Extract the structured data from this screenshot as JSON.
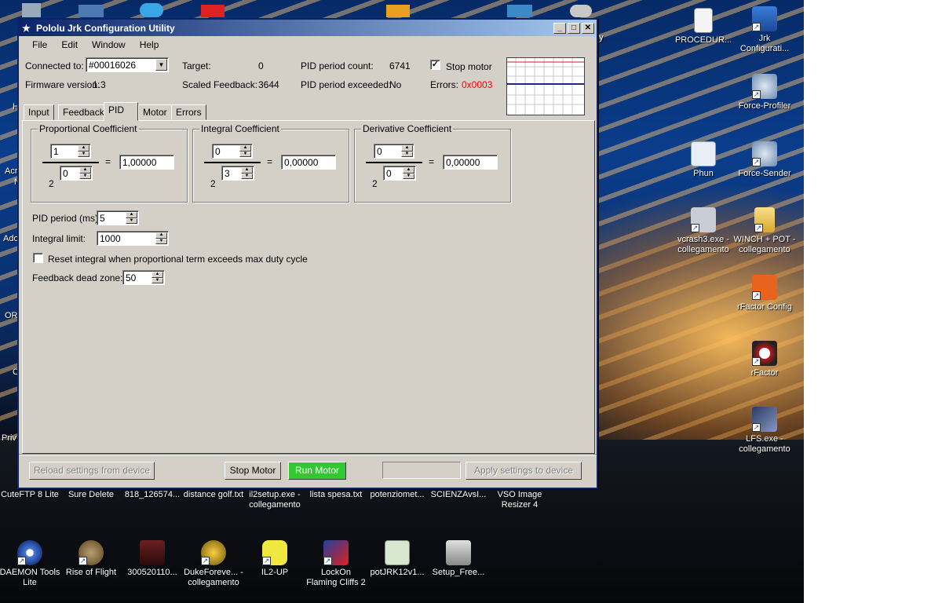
{
  "window": {
    "title": "Pololu Jrk Configuration Utility"
  },
  "menu": [
    "File",
    "Edit",
    "Window",
    "Help"
  ],
  "status": {
    "connected_label": "Connected to:",
    "connected_value": "#00016026",
    "firmware_label": "Firmware version:",
    "firmware_value": "1.3",
    "target_label": "Target:",
    "target_value": "0",
    "scaled_label": "Scaled Feedback:",
    "scaled_value": "3644",
    "pid_count_label": "PID period count:",
    "pid_count_value": "6741",
    "pid_exceeded_label": "PID period exceeded:",
    "pid_exceeded_value": "No",
    "stop_motor_label": "Stop motor",
    "errors_label": "Errors:",
    "errors_value": "0x0003",
    "error_color": "#ff0000"
  },
  "tabs": [
    "Input",
    "Feedback",
    "PID",
    "Motor",
    "Errors"
  ],
  "active_tab": "PID",
  "pid": {
    "proportional": {
      "title": "Proportional Coefficient",
      "numerator": "1",
      "base": "2",
      "exponent": "0",
      "eq": "=",
      "result": "1,00000"
    },
    "integral": {
      "title": "Integral Coefficient",
      "numerator": "0",
      "base": "2",
      "exponent": "3",
      "eq": "=",
      "result": "0,00000"
    },
    "derivative": {
      "title": "Derivative Coefficient",
      "numerator": "0",
      "base": "2",
      "exponent": "0",
      "eq": "=",
      "result": "0,00000"
    },
    "period_label": "PID period (ms):",
    "period_value": "5",
    "integral_limit_label": "Integral limit:",
    "integral_limit_value": "1000",
    "reset_integral_label": "Reset integral when proportional term exceeds max duty cycle",
    "deadzone_label": "Feedback dead zone:",
    "deadzone_value": "50"
  },
  "footer": {
    "reload": "Reload settings from device",
    "stop": "Stop Motor",
    "run": "Run Motor",
    "apply": "Apply settings to device",
    "run_color": "#32c832"
  },
  "desktop": {
    "right_icons": [
      {
        "label": "PROCEDUR...",
        "icon": "document-icon"
      },
      {
        "label": "Jrk Configurati...",
        "icon": "jrk-icon"
      },
      {
        "label": "Force-Profiler",
        "icon": "force-profiler-icon"
      },
      {
        "label": "Phun",
        "icon": "phun-icon"
      },
      {
        "label": "Force-Sender",
        "icon": "force-sender-icon"
      },
      {
        "label": "vcrash3.exe - collegamento",
        "icon": "vcrash-icon"
      },
      {
        "label": "WINCH + POT - collegamento",
        "icon": "folder-icon"
      },
      {
        "label": "rFactor Config",
        "icon": "rfactor-config-icon"
      },
      {
        "label": "rFactor",
        "icon": "rfactor-icon"
      },
      {
        "label": "LFS.exe - collegamento",
        "icon": "lfs-icon"
      }
    ],
    "row1": [
      {
        "label": "CuteFTP 8 Lite"
      },
      {
        "label": "Sure Delete"
      },
      {
        "label": "818_126574..."
      },
      {
        "label": "distance golf.txt"
      },
      {
        "label": "il2setup.exe - collegamento"
      },
      {
        "label": "lista spesa.txt"
      },
      {
        "label": "potenziomet..."
      },
      {
        "label": "SCIENZAvsI..."
      },
      {
        "label": "VSO Image Resizer 4"
      }
    ],
    "row2": [
      {
        "label": "DAEMON Tools Lite"
      },
      {
        "label": "Rise of Flight"
      },
      {
        "label": "300520110..."
      },
      {
        "label": "DukeForeve... - collegamento"
      },
      {
        "label": "IL2-UP"
      },
      {
        "label": "LockOn Flaming Cliffs 2"
      },
      {
        "label": "potJRK12v1..."
      },
      {
        "label": "Setup_Free..."
      }
    ],
    "left_cut": [
      "Acr",
      "N",
      "Ado",
      "OR",
      "C",
      "Priv",
      "H"
    ],
    "behind_title": "ey"
  }
}
